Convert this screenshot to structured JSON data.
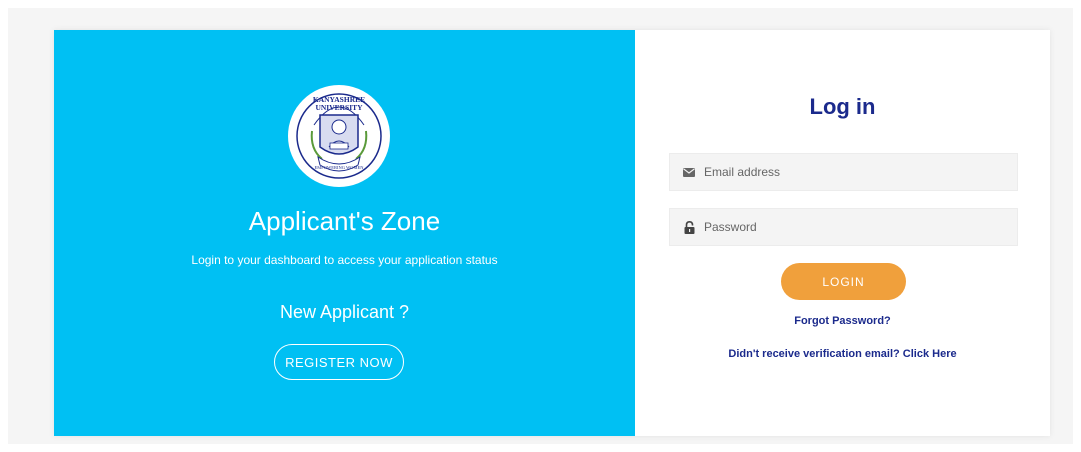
{
  "brand": {
    "logo_text_top": "KANYASHREE UNIVERSITY",
    "logo_text_bottom": "EMPOWERING WOMEN",
    "accent_color": "#00c0f3",
    "primary_text_color": "#1b2a8c",
    "button_color": "#f0a03c"
  },
  "left": {
    "title": "Applicant's Zone",
    "subtitle": "Login to your dashboard to access your application status",
    "new_applicant": "New Applicant ?",
    "register_label": "REGISTER NOW"
  },
  "login": {
    "title": "Log in",
    "email": {
      "placeholder": "Email address",
      "value": "",
      "icon": "envelope-icon"
    },
    "password": {
      "placeholder": "Password",
      "value": "",
      "icon": "lock-icon"
    },
    "login_label": "LOGIN",
    "forgot_label": "Forgot Password?",
    "verify_label": "Didn't receive verification email? Click Here"
  }
}
